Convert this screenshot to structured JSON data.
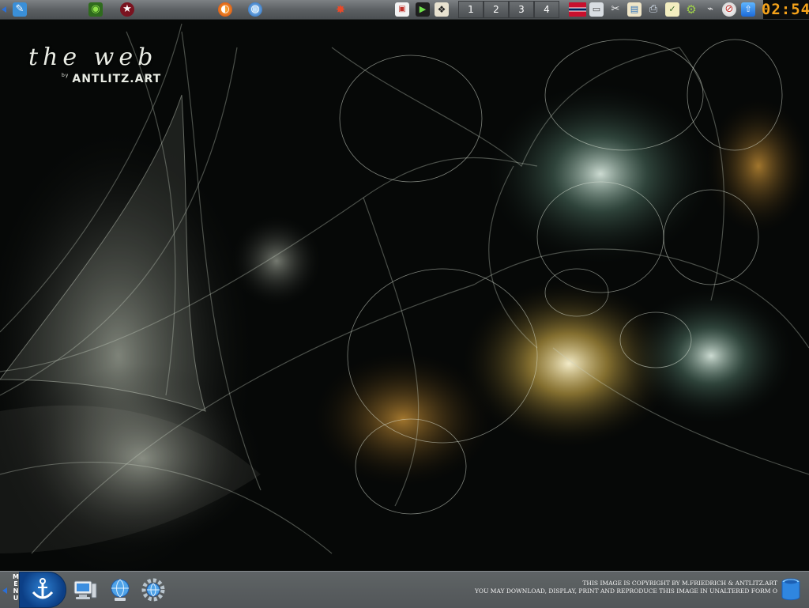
{
  "wallpaper": {
    "title": "the web",
    "by": "by",
    "brand": "ANTLITZ.ART",
    "copyright_line1": "THIS IMAGE IS COPYRIGHT BY M.FRIEDRICH & ANTLITZ.ART",
    "copyright_line2": "YOU MAY DOWNLOAD, DISPLAY, PRINT AND REPRODUCE THIS IMAGE IN UNALTERED FORM O"
  },
  "top_panel": {
    "launchers": [
      {
        "icon": "text-editor-icon"
      },
      {
        "icon": "nvidia-settings-icon"
      },
      {
        "icon": "app-star-icon"
      },
      {
        "icon": "firefox-icon"
      },
      {
        "icon": "browser-globe-icon"
      },
      {
        "icon": "red-app-icon"
      }
    ],
    "workspaces": [
      "1",
      "2",
      "3",
      "4"
    ],
    "tray": [
      "pdf-viewer-icon",
      "terminal-icon",
      "paw-icon",
      "norway-flag-icon",
      "display-icon",
      "scissors-icon",
      "photo-icon",
      "printer-icon",
      "notes-icon",
      "settings-gear-icon",
      "network-icon",
      "compass-icon",
      "update-icon"
    ],
    "clock": "02:54"
  },
  "bottom_panel": {
    "menu_label": "MENU",
    "launchers": [
      "computer-icon",
      "network-globe-icon",
      "system-settings-icon"
    ],
    "trash": "trash-icon"
  },
  "colors": {
    "accent": "#2b6fd6",
    "clock_text": "#f5a21a",
    "panel": "#5d6164"
  }
}
